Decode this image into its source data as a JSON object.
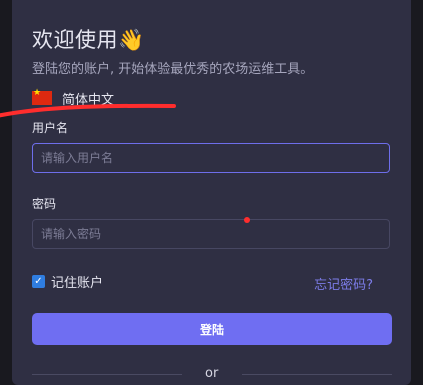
{
  "header": {
    "title": "欢迎使用👋",
    "subtitle": "登陆您的账户, 开始体验最优秀的农场运维工具。"
  },
  "language": {
    "flag_icon": "china-flag-icon",
    "label": "简体中文"
  },
  "username": {
    "label": "用户名",
    "placeholder": "请输入用户名",
    "value": ""
  },
  "password": {
    "label": "密码",
    "placeholder": "请输入密码",
    "value": ""
  },
  "remember": {
    "label": "记住账户",
    "checked": true
  },
  "forgot_label": "忘记密码?",
  "login_label": "登陆",
  "divider_label": "or",
  "colors": {
    "accent": "#6f6ef2",
    "link": "#7c7ce8",
    "card": "#2f2f43",
    "annotation": "#ff2d2d"
  }
}
